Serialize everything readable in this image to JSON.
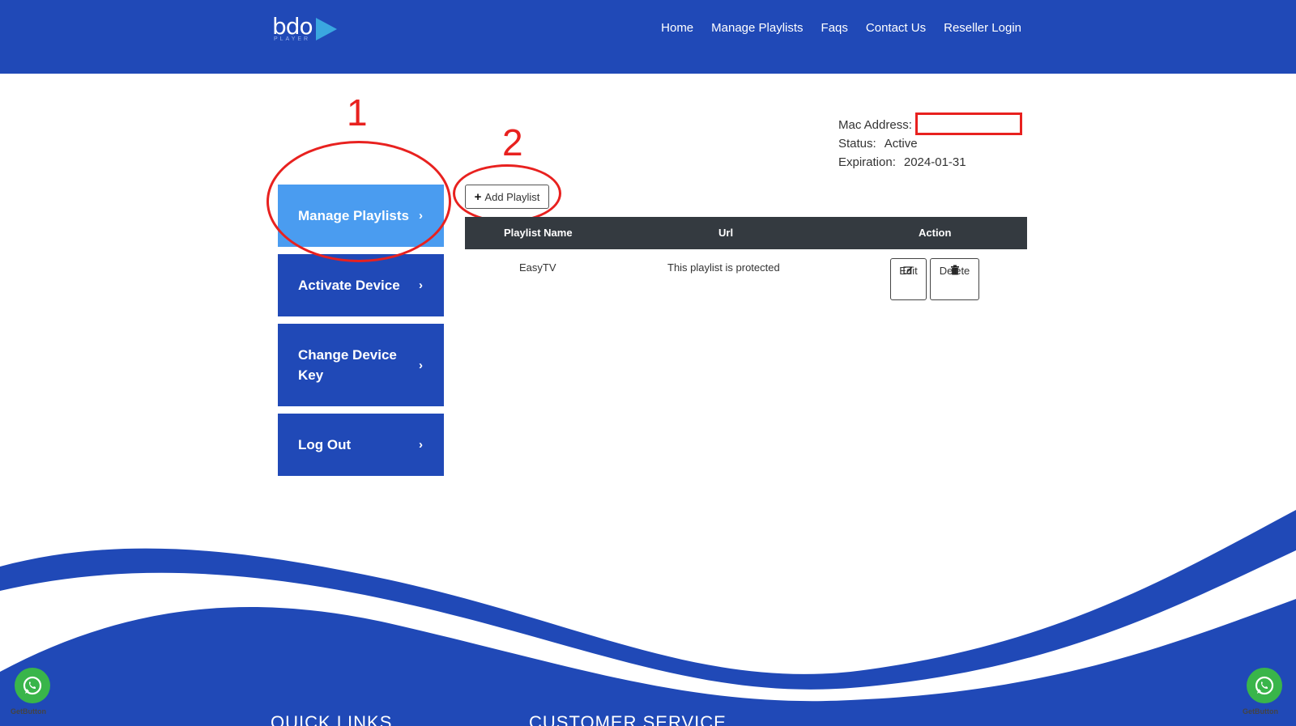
{
  "header": {
    "logo_text": "bdo",
    "logo_sub": "PLAYER",
    "nav": [
      "Home",
      "Manage Playlists",
      "Faqs",
      "Contact Us",
      "Reseller Login"
    ]
  },
  "sidebar": {
    "items": [
      {
        "label": "Manage Playlists",
        "active": true
      },
      {
        "label": "Activate Device",
        "active": false
      },
      {
        "label": "Change Device Key",
        "active": false
      },
      {
        "label": "Log Out",
        "active": false
      }
    ],
    "chevron": "›"
  },
  "annotations": {
    "one": "1",
    "two": "2"
  },
  "device_info": {
    "mac_label": "Mac Address:",
    "mac_value": "",
    "status_label": "Status:",
    "status_value": "Active",
    "expiration_label": "Expiration:",
    "expiration_value": "2024-01-31"
  },
  "toolbar": {
    "add_playlist_label": "Add Playlist",
    "add_icon": "plus-icon"
  },
  "table": {
    "columns": [
      "Playlist Name",
      "Url",
      "Action"
    ],
    "rows": [
      {
        "name": "EasyTV",
        "url": "This playlist is protected",
        "edit_label": "Edit",
        "delete_label": "Delete"
      }
    ]
  },
  "footer": {
    "quick_links": "QUICK LINKS",
    "customer_service": "CUSTOMER SERVICE",
    "getbutton_label": "GetButton"
  },
  "colors": {
    "brand": "#2049b7",
    "active": "#4a9cf0",
    "annotation": "#e8211f",
    "whatsapp": "#39b54a"
  }
}
